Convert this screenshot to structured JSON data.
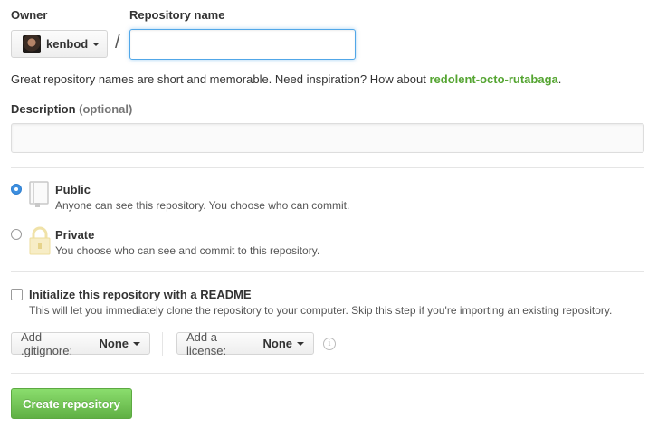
{
  "owner": {
    "label": "Owner",
    "value": "kenbod"
  },
  "separator": "/",
  "repo_name": {
    "label": "Repository name",
    "value": ""
  },
  "hint": {
    "text": "Great repository names are short and memorable. Need inspiration? How about ",
    "suggestion": "redolent-octo-rutabaga",
    "end": "."
  },
  "description": {
    "label": "Description",
    "optional": "(optional)",
    "value": ""
  },
  "visibility": {
    "selected": "public",
    "public": {
      "title": "Public",
      "desc": "Anyone can see this repository. You choose who can commit."
    },
    "private": {
      "title": "Private",
      "desc": "You choose who can see and commit to this repository."
    }
  },
  "readme": {
    "title": "Initialize this repository with a README",
    "desc": "This will let you immediately clone the repository to your computer. Skip this step if you're importing an existing repository.",
    "checked": false
  },
  "gitignore": {
    "label": "Add .gitignore:",
    "value": "None"
  },
  "license": {
    "label": "Add a license:",
    "value": "None"
  },
  "info_icon": "i",
  "create_button": "Create repository",
  "colors": {
    "accent": "#51a7e8",
    "green": "#55a532",
    "button_green": "#60b044"
  }
}
